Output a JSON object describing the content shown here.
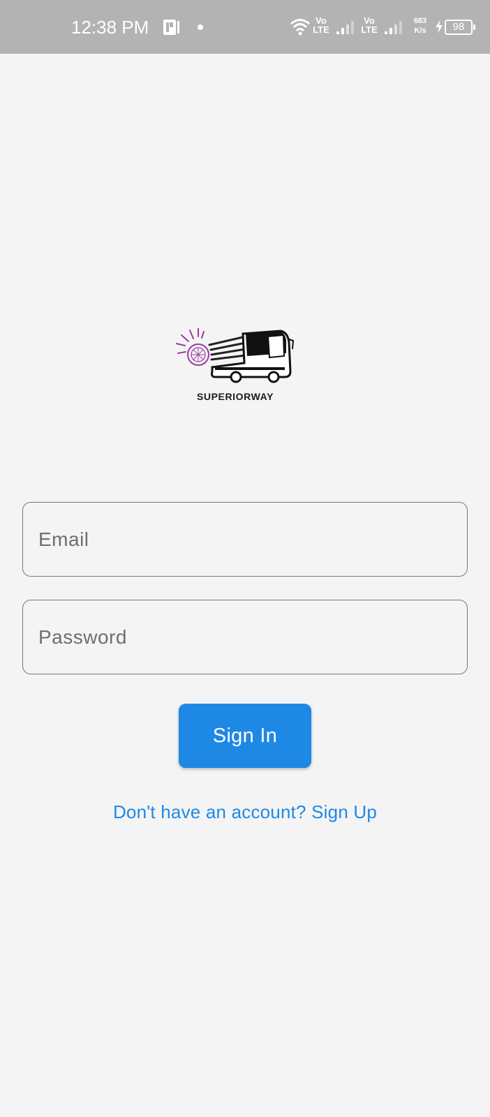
{
  "status_bar": {
    "time": "12:38 PM",
    "volte1_top": "Vo",
    "volte1_bottom": "LTE",
    "volte2_top": "Vo",
    "volte2_bottom": "LTE",
    "speed_value": "683",
    "speed_unit": "K/s",
    "battery": "98",
    "icons": [
      "notification-icon",
      "dot-icon",
      "wifi-icon",
      "signal-icon",
      "signal-icon",
      "charging-icon",
      "battery-icon"
    ]
  },
  "logo": {
    "text": "SUPERIORWAY",
    "icon": "bus-logo-icon",
    "accent": "#9c3aa0"
  },
  "form": {
    "email_placeholder": "Email",
    "email_value": "",
    "password_placeholder": "Password",
    "password_value": "",
    "signin_label": "Sign In",
    "signup_link": "Don't have an account? Sign Up"
  },
  "colors": {
    "background": "#f4f4f5",
    "status_bar": "#b3b3b3",
    "primary": "#1e88e5",
    "field_border": "#777777"
  }
}
